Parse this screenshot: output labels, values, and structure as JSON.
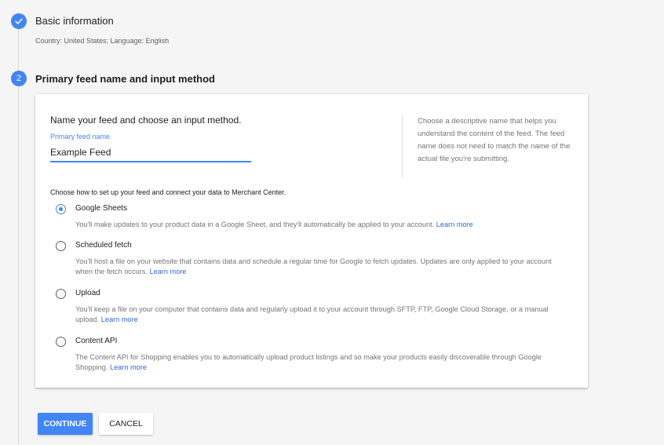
{
  "colors": {
    "accent": "#4285f4",
    "link": "#3367d6",
    "background": "#f5f5f5"
  },
  "steps": [
    {
      "number": "",
      "icon": "check-icon",
      "title": "Basic information",
      "subtitle": "Country: United States; Language: English"
    },
    {
      "number": "2",
      "title": "Primary feed name and input method"
    }
  ],
  "card": {
    "heading": "Name your feed and choose an input method.",
    "field_label": "Primary feed name",
    "field_value": "Example Feed",
    "help_text": "Choose a descriptive name that helps you understand the content of the feed. The feed name does not need to match the name of the actual file you're submitting.",
    "method_prompt": "Choose how to set up your feed and connect your data to Merchant Center.",
    "options": [
      {
        "title": "Google Sheets",
        "selected": true,
        "description": "You'll make updates to your product data in a Google Sheet, and they'll automatically be applied to your account.",
        "link": "Learn more"
      },
      {
        "title": "Scheduled fetch",
        "selected": false,
        "description": "You'll host a file on your website that contains data and schedule a regular time for Google to fetch updates. Updates are only applied to your account when the fetch occurs.",
        "link": "Learn more"
      },
      {
        "title": "Upload",
        "selected": false,
        "description": "You'll keep a file on your computer that contains data and regularly upload it to your account through SFTP, FTP, Google Cloud Storage, or a manual upload.",
        "link": "Learn more"
      },
      {
        "title": "Content API",
        "selected": false,
        "description": "The Content API for Shopping enables you to automatically upload product listings and so make your products easily discoverable through Google Shopping.",
        "link": "Learn more"
      }
    ]
  },
  "buttons": {
    "continue": "CONTINUE",
    "cancel": "CANCEL"
  }
}
